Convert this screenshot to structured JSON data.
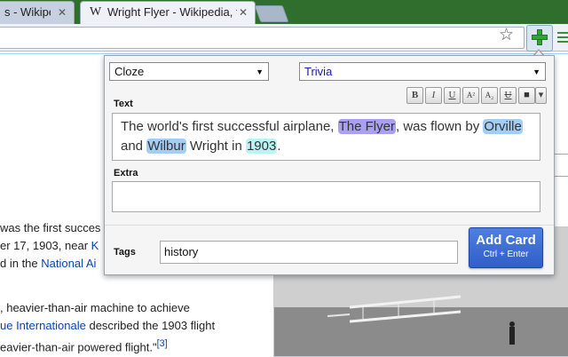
{
  "browser": {
    "tabs": [
      {
        "favicon": "",
        "title": "s - Wikiped",
        "close": "✕"
      },
      {
        "favicon": "W",
        "title": "Wright Flyer - Wikipedia, t",
        "close": "✕"
      }
    ],
    "new_tab_icon": "new-tab-icon",
    "bookmark_icon": "star-icon",
    "extension_icon": "plus-icon",
    "menu_icon": "menu-icon"
  },
  "article": {
    "lines": [
      {
        "pre": "was the first succes",
        "link": "",
        "post": ""
      },
      {
        "pre": "er 17, 1903, near ",
        "link": "K",
        "post": ""
      },
      {
        "pre": "d in the ",
        "link": "National Ai",
        "post": ""
      },
      {
        "pre": ", heavier-than-air machine to achieve",
        "link": "",
        "post": ""
      },
      {
        "pre": "",
        "link": "ue Internationale",
        "post": " described the 1903 flight"
      },
      {
        "pre": "eavier-than-air powered flight.\"",
        "link": "[3]",
        "post": ""
      }
    ]
  },
  "popup": {
    "model_select": {
      "value": "Cloze",
      "options_caret": "▼"
    },
    "deck_select": {
      "value": "Trivia",
      "options_caret": "▼"
    },
    "fields": {
      "text_label": "Text",
      "text_segments": [
        {
          "text": "The world's first successful airplane, ",
          "hl": ""
        },
        {
          "text": "The Flyer",
          "hl": "purple"
        },
        {
          "text": ", was flown by ",
          "hl": ""
        },
        {
          "text": "Orville",
          "hl": "blue"
        },
        {
          "text": " and ",
          "hl": ""
        },
        {
          "text": "Wilbur",
          "hl": "blue"
        },
        {
          "text": " Wright in ",
          "hl": ""
        },
        {
          "text": "1903",
          "hl": "cyan"
        },
        {
          "text": ".",
          "hl": ""
        }
      ],
      "extra_label": "Extra",
      "extra_value": ""
    },
    "formatting": {
      "bold": "B",
      "italic": "I",
      "underline": "U",
      "superscript": "A²",
      "subscript": "A₂",
      "clear_format": "U",
      "color": "■",
      "more": "▾"
    },
    "tags_label": "Tags",
    "tags_value": "history",
    "add_button": {
      "label": "Add Card",
      "shortcut": "Ctrl + Enter"
    }
  },
  "colors": {
    "highlight_purple": "#a9a0f0",
    "highlight_blue": "#a4cdf5",
    "highlight_cyan": "#b9f4f4",
    "add_button": "#3d6ed8"
  }
}
